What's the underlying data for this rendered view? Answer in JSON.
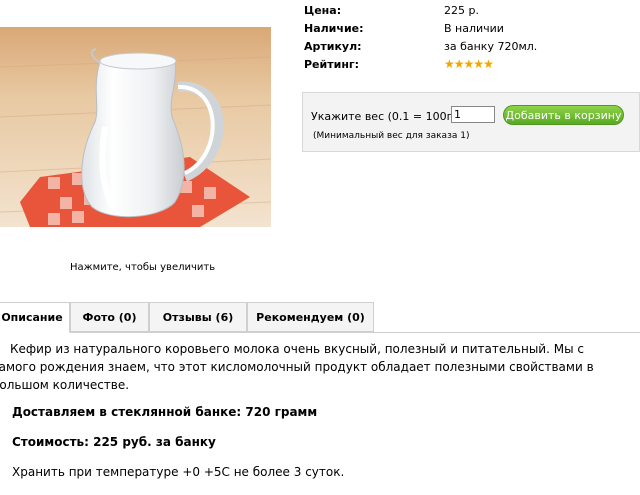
{
  "product": {
    "price_label": "Цена:",
    "price_value": "225 р.",
    "availability_label": "Наличие:",
    "availability_value": "В наличии",
    "sku_label": "Артикул:",
    "sku_value": "за банку 720мл.",
    "rating_label": "Рейтинг:",
    "rating_stars": 5,
    "rating_max": 5,
    "image_caption": "Нажмите, чтобы увеличить"
  },
  "order": {
    "weight_label": "Укажите вес (0.1 = 100гр):",
    "weight_value": "1",
    "add_to_cart_label": "Добавить в корзину",
    "min_weight_note": "(Минимальный вес для заказа 1)",
    "button_color": "#6cbd2f"
  },
  "tabs": [
    {
      "label": "Описание"
    },
    {
      "label": "Фото (0)"
    },
    {
      "label": "Отзывы (6)"
    },
    {
      "label": "Рекомендуем (0)"
    }
  ],
  "description": {
    "paragraph": "Кефир из натурального коровьего молока очень вкусный, полезный и питательный. Мы с самого рождения знаем, что этот кисломолочный продукт обладает полезными свойствами в большом количестве.",
    "bold_line_1": "Доставляем в стеклянной банке: 720 грамм",
    "bold_line_2": "Стоимость: 225 руб. за банку",
    "storage_line": "Хранить при температуре +0 +5С не более 3 суток."
  }
}
